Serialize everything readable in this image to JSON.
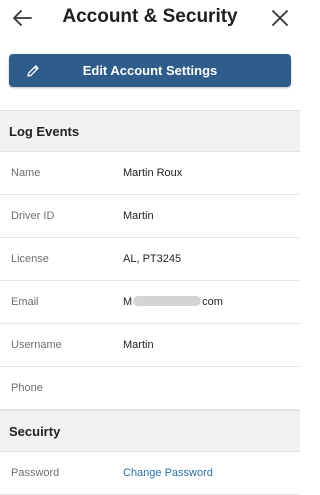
{
  "header": {
    "title": "Account & Security",
    "back_icon": "arrow-left-icon",
    "close_icon": "close-icon"
  },
  "edit_button": {
    "label": "Edit Account Settings",
    "icon": "pencil-icon",
    "color": "#2e5d8c"
  },
  "log_events": {
    "title": "Log Events",
    "rows": [
      {
        "label": "Name",
        "value": "Martin Roux"
      },
      {
        "label": "Driver ID",
        "value": "Martin"
      },
      {
        "label": "License",
        "value": "AL, PT3245"
      },
      {
        "label": "Email",
        "value_prefix": "M",
        "value_suffix": "com"
      },
      {
        "label": "Username",
        "value": "Martin"
      },
      {
        "label": "Phone",
        "value": ""
      }
    ]
  },
  "security": {
    "title": "Secuirty",
    "rows": [
      {
        "label": "Password",
        "link": "Change Password"
      }
    ]
  },
  "colors": {
    "accent": "#2e5d8c",
    "link": "#2e6fa8",
    "section_bg": "#f2f2f2"
  }
}
